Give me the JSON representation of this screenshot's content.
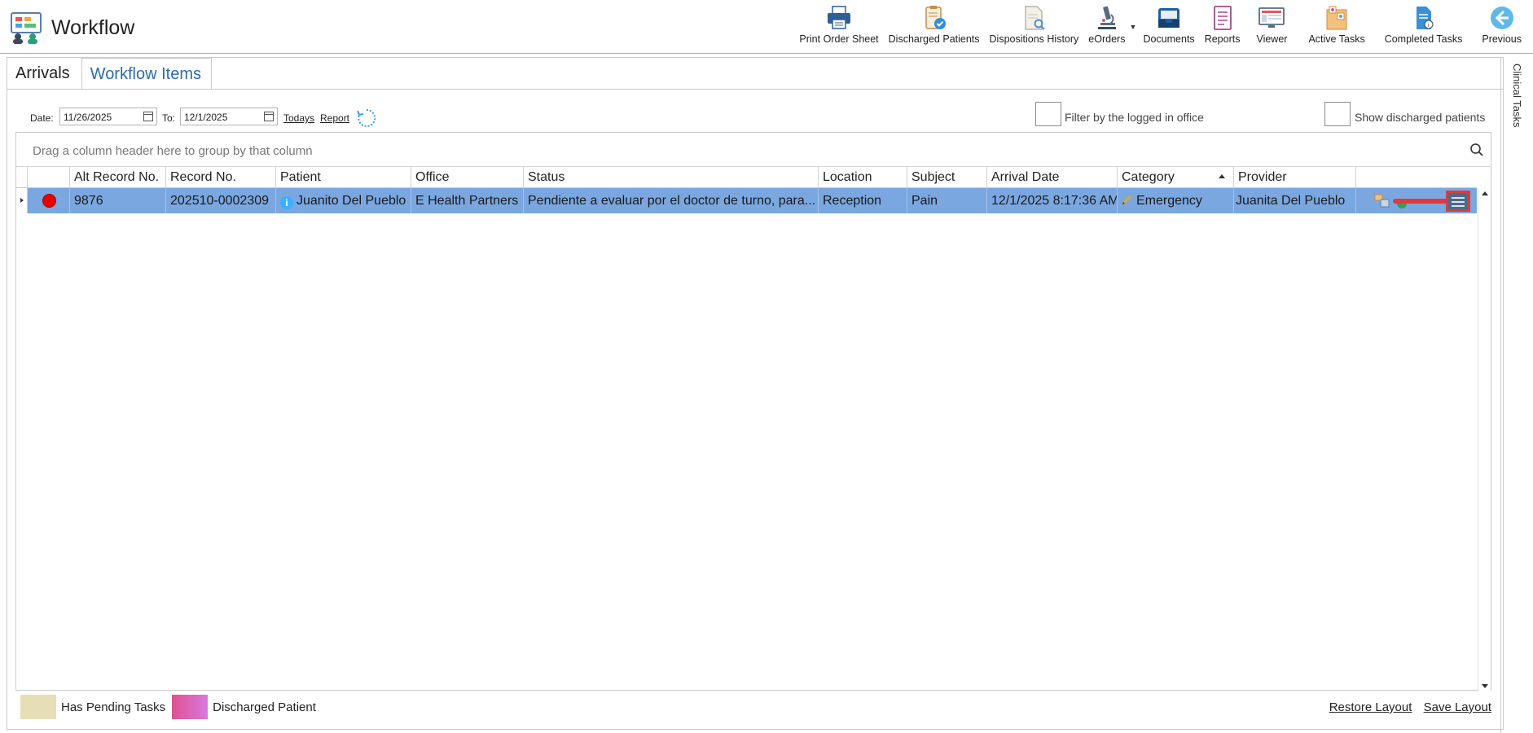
{
  "app": {
    "title": "Workflow"
  },
  "toolbar": [
    {
      "label": "Print Order Sheet",
      "icon": "printer-icon"
    },
    {
      "label": "Discharged Patients",
      "icon": "clipboard-check-icon"
    },
    {
      "label": "Dispositions History",
      "icon": "document-search-icon"
    },
    {
      "label": "eOrders",
      "icon": "microscope-icon"
    },
    {
      "label": "Documents",
      "icon": "inbox-tray-icon"
    },
    {
      "label": "Reports",
      "icon": "report-icon"
    },
    {
      "label": "Viewer",
      "icon": "monitor-icon"
    },
    {
      "label": "Active Tasks",
      "icon": "task-board-icon"
    },
    {
      "label": "Completed Tasks",
      "icon": "completed-doc-icon"
    },
    {
      "label": "Previous",
      "icon": "back-arrow-icon"
    }
  ],
  "side_panel": {
    "label": "Clinical Tasks"
  },
  "tabs": [
    {
      "label": "Arrivals"
    },
    {
      "label": "Workflow Items"
    }
  ],
  "filters": {
    "date_label": "Date:",
    "date_from": "11/26/2025",
    "to_label": "To:",
    "date_to": "12/1/2025",
    "todays_link": "Todays",
    "report_link": "Report",
    "filter_office_label": "Filter by the logged in office",
    "show_discharged_label": "Show discharged patients"
  },
  "grid": {
    "group_panel_text": "Drag a column header here to group by that column",
    "columns": [
      "Alt Record No.",
      "Record No.",
      "Patient",
      "Office",
      "Status",
      "Location",
      "Subject",
      "Arrival Date",
      "Category",
      "Provider"
    ],
    "sort_column": "Category",
    "rows": [
      {
        "alt_record_no": "9876",
        "record_no": "202510-0002309",
        "patient": "Juanito Del Pueblo",
        "office": "E Health Partners",
        "status": "Pendiente a evaluar por el doctor de turno, para...",
        "location": "Reception",
        "subject": "Pain",
        "arrival_date": "12/1/2025 8:17:36 AM",
        "category": "Emergency",
        "provider": "Juanita Del Pueblo"
      }
    ]
  },
  "legend": {
    "pending_label": "Has Pending Tasks",
    "pending_color": "#e6dfb5",
    "discharged_label": "Discharged Patient",
    "discharged_color": "#e060a8"
  },
  "footer": {
    "restore_layout": "Restore Layout",
    "save_layout": "Save Layout"
  },
  "colors": {
    "selected_row": "#7aa7e0",
    "link_blue": "#2a6bb0",
    "annotation_red": "#e03a3a"
  }
}
